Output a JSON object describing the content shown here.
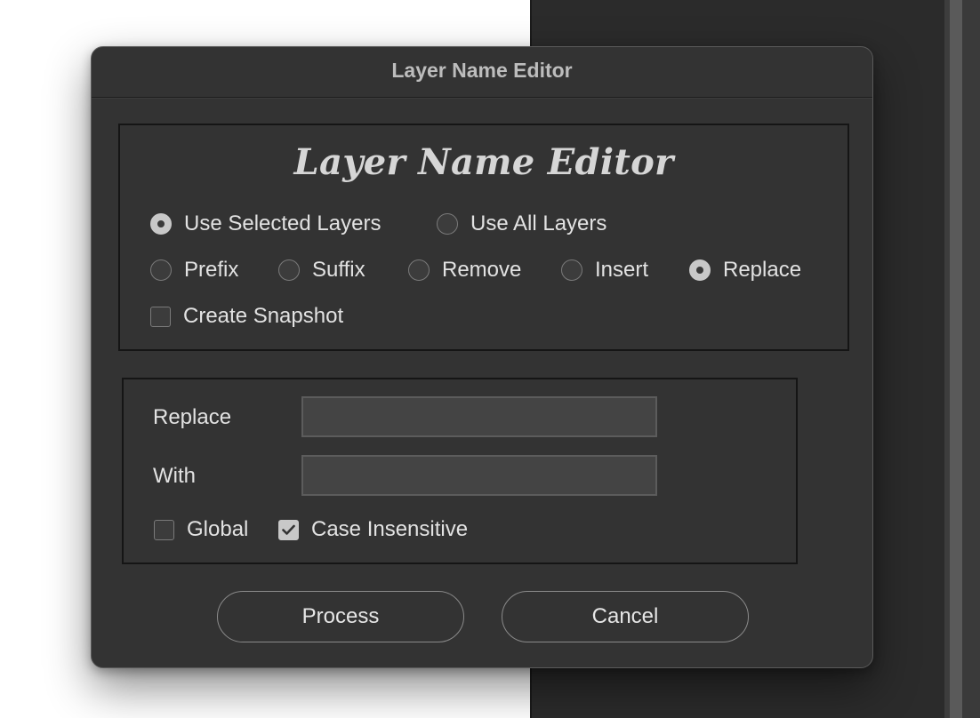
{
  "window": {
    "title": "Layer Name Editor"
  },
  "options_panel": {
    "heading": "Layer Name Editor",
    "scope": [
      {
        "label": "Use Selected Layers",
        "checked": true
      },
      {
        "label": "Use All Layers",
        "checked": false
      }
    ],
    "modes": [
      {
        "label": "Prefix",
        "checked": false
      },
      {
        "label": "Suffix",
        "checked": false
      },
      {
        "label": "Remove",
        "checked": false
      },
      {
        "label": "Insert",
        "checked": false
      },
      {
        "label": "Replace",
        "checked": true
      }
    ],
    "snapshot": {
      "label": "Create Snapshot",
      "checked": false
    }
  },
  "replace_panel": {
    "replace_label": "Replace",
    "replace_value": "",
    "with_label": "With",
    "with_value": "",
    "global": {
      "label": "Global",
      "checked": false
    },
    "case_insensitive": {
      "label": "Case Insensitive",
      "checked": true
    }
  },
  "buttons": {
    "process": "Process",
    "cancel": "Cancel"
  },
  "colors": {
    "dialog_bg": "#333333",
    "panel_border": "#151515",
    "control_checked": "#c8c8c8",
    "text": "#e2e2e2"
  },
  "icons": {
    "checkmark": "check-icon"
  }
}
